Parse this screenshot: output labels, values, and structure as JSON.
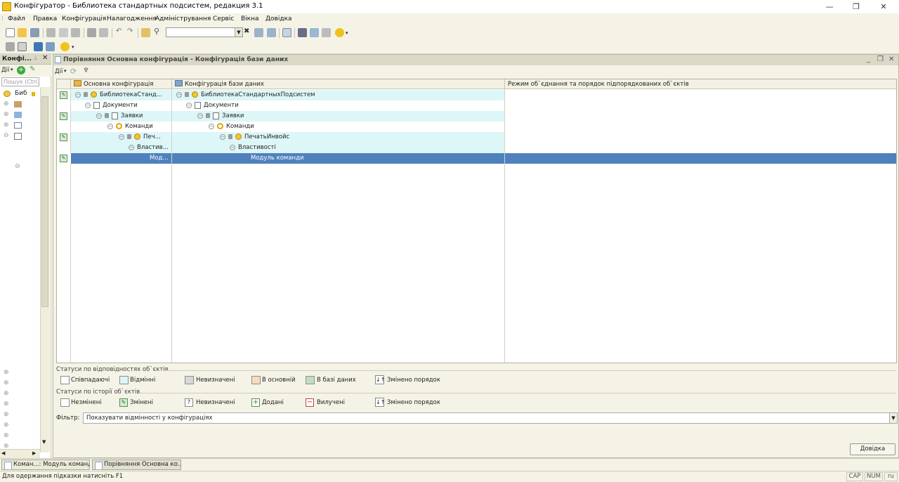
{
  "window": {
    "title": "Конфігуратор - Библиотека стандартных подсистем, редакция 3.1",
    "minimize_icon": "minimize-icon",
    "restore_icon": "restore-icon",
    "close_icon": "close-icon"
  },
  "menu": [
    "Файл",
    "Правка",
    "Конфігурація",
    "Налагодження",
    "Адміністрування",
    "Сервіс",
    "Вікна",
    "Довідка"
  ],
  "left_panel": {
    "title": "Конфі...",
    "actions_label": "Дії",
    "search_placeholder": "Пошук (Ctrl...",
    "root_item": "Биб"
  },
  "compare_window": {
    "title": "Порівняння Основна конфігурація - Конфігурація бази даних",
    "actions_label": "Дії",
    "columns": [
      "Основна конфігурація",
      "Конфігурація бази даних",
      "Режим об`єднання та порядок підпорядкованих об`єктів"
    ],
    "rows": [
      {
        "left": "БиблиотекаСтанд...",
        "right": "БиблиотекаСтандартныхПодсистем",
        "changed": true
      },
      {
        "left": "Документи",
        "right": "Документи",
        "changed": false
      },
      {
        "left": "Заявки",
        "right": "Заявки",
        "changed": true
      },
      {
        "left": "Команди",
        "right": "Команди",
        "changed": false
      },
      {
        "left": "Печ...",
        "right": "ПечатьИнвойс",
        "changed": true
      },
      {
        "left": "Властив...",
        "right": "Властивості",
        "changed": false
      },
      {
        "left": "Мод...",
        "right": "Модуль команди",
        "changed": true,
        "selected": true
      }
    ]
  },
  "legend": {
    "match_title": "Статуси по відповідностях об`єктів",
    "match_items": [
      "Співпадаючі",
      "Відмінні",
      "Невизначені",
      "В основній",
      "В базі даних",
      "Змінено порядок"
    ],
    "history_title": "Статуси по історії об`єктів",
    "history_items": [
      "Незмінені",
      "Змінені",
      "Невизначені",
      "Додані",
      "Вилучені",
      "Змінено порядок"
    ]
  },
  "filter": {
    "label": "Фільтр:",
    "value": "Показувати відмінності у конфігураціях"
  },
  "help_button": "Довідка",
  "taskbar": [
    "Коман...: Модуль команди",
    "Порівняння Основна ко..."
  ],
  "status": {
    "hint": "Для одержання підказки натисніть F1",
    "indicators": [
      "CAP",
      "NUM",
      "ru"
    ]
  },
  "colors": {
    "diff_row": "#ddf6f8",
    "selected_row": "#4f81bd",
    "undefined_box": "#d8d8d8",
    "in_main_box": "#f8dcc1",
    "in_db_box": "#c3dcc0"
  }
}
